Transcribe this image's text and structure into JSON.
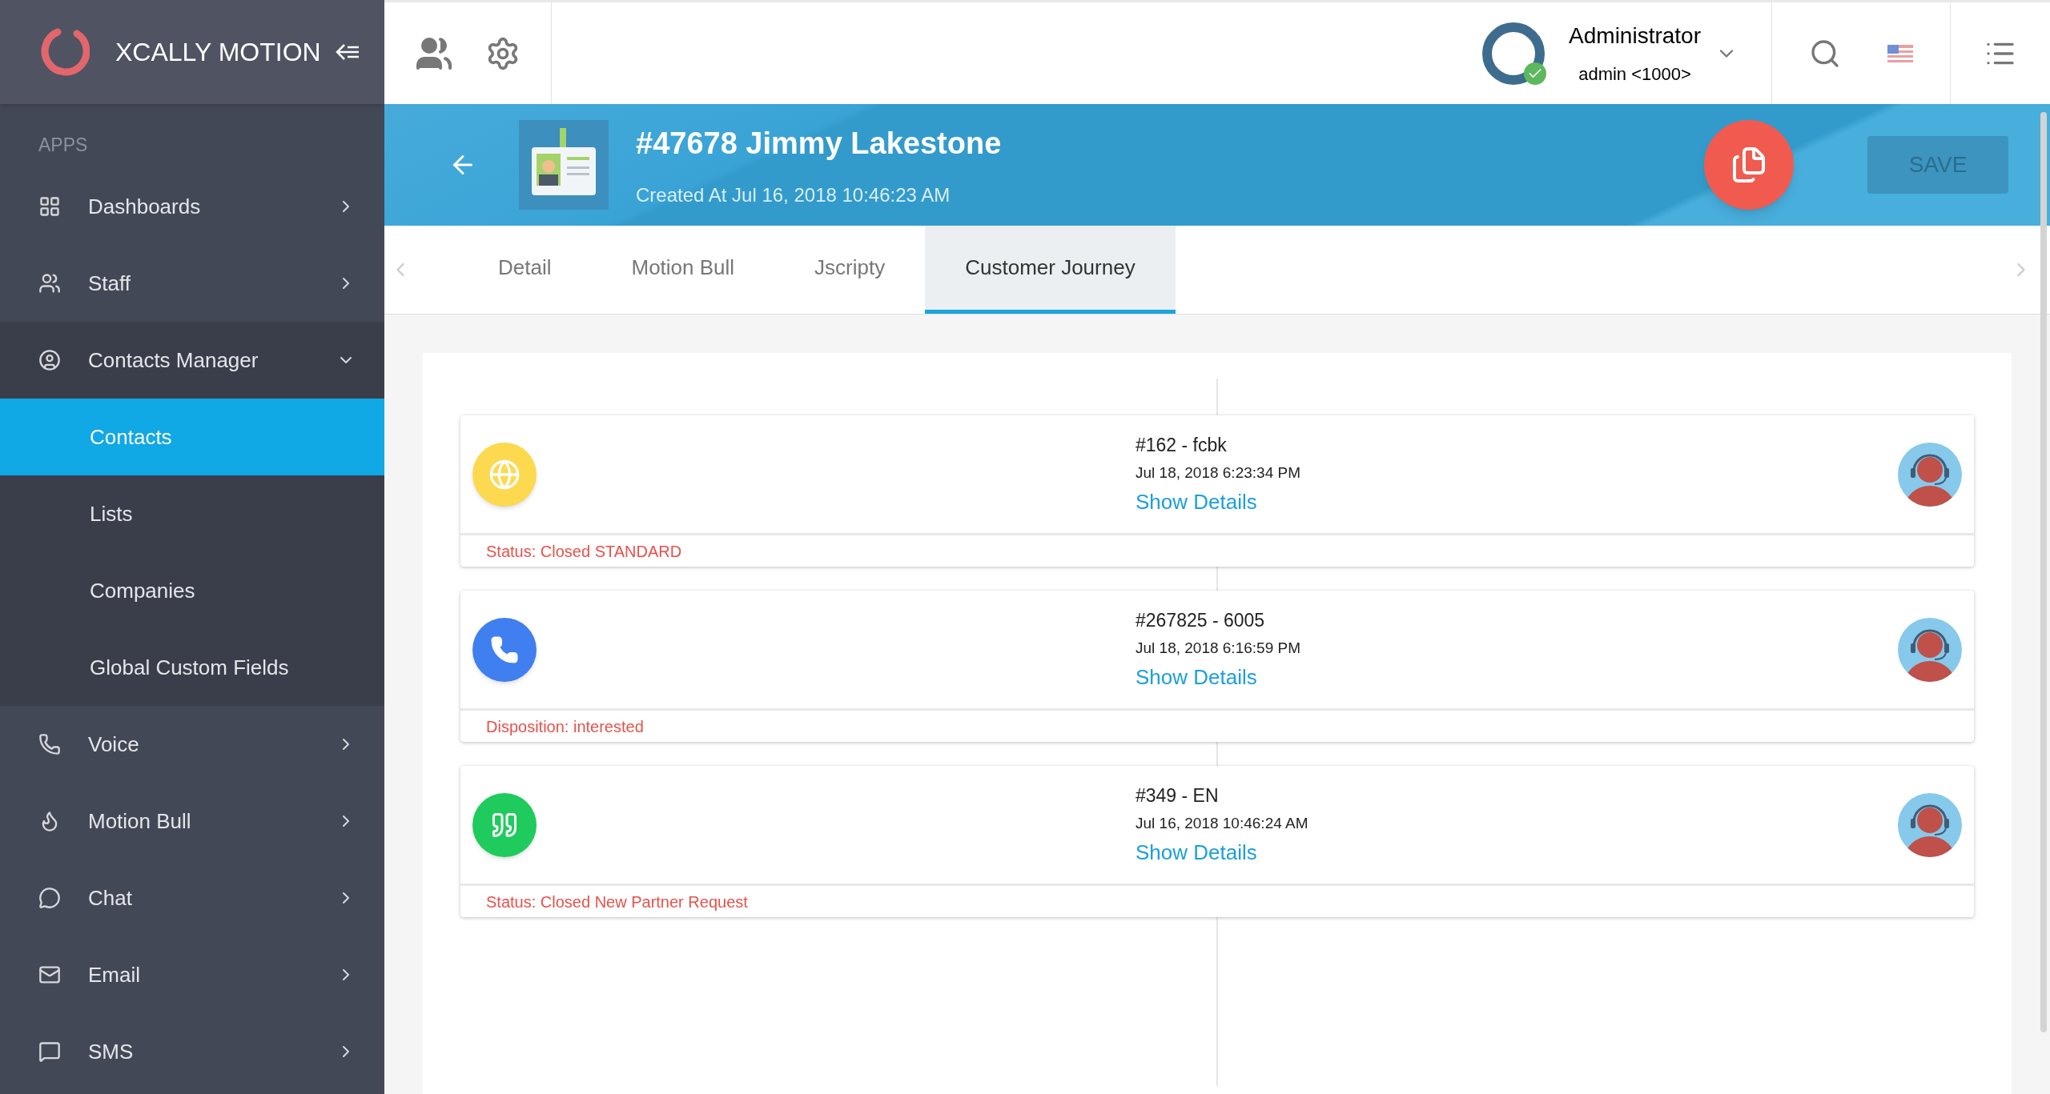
{
  "brand": {
    "name": "XCALLY MOTION"
  },
  "sidebar": {
    "section": "APPS",
    "items": [
      {
        "label": "Dashboards",
        "expanded": false
      },
      {
        "label": "Staff",
        "expanded": false
      },
      {
        "label": "Contacts Manager",
        "expanded": true,
        "children": [
          {
            "label": "Contacts",
            "selected": true
          },
          {
            "label": "Lists",
            "selected": false
          },
          {
            "label": "Companies",
            "selected": false
          },
          {
            "label": "Global Custom Fields",
            "selected": false
          }
        ]
      },
      {
        "label": "Voice",
        "expanded": false
      },
      {
        "label": "Motion Bull",
        "expanded": false
      },
      {
        "label": "Chat",
        "expanded": false
      },
      {
        "label": "Email",
        "expanded": false
      },
      {
        "label": "SMS",
        "expanded": false
      }
    ]
  },
  "user": {
    "name": "Administrator",
    "account": "admin <1000>",
    "online": true
  },
  "contact": {
    "title": "#47678 Jimmy Lakestone",
    "created": "Created At Jul 16, 2018 10:46:23 AM",
    "save": {
      "label": "SAVE",
      "disabled": true
    }
  },
  "tabs": [
    {
      "label": "Detail",
      "selected": false
    },
    {
      "label": "Motion Bull",
      "selected": false
    },
    {
      "label": "Jscripty",
      "selected": false
    },
    {
      "label": "Customer Journey",
      "selected": true
    }
  ],
  "journey": [
    {
      "kind": "social",
      "color": "#fdd94f",
      "title": "#162 - fcbk",
      "date": "Jul 18, 2018 6:23:34 PM",
      "link": "Show Details",
      "footer": "Status: Closed STANDARD"
    },
    {
      "kind": "voice",
      "color": "#3f7ff0",
      "title": "#267825 - 6005",
      "date": "Jul 18, 2018 6:16:59 PM",
      "link": "Show Details",
      "footer": "Disposition: interested"
    },
    {
      "kind": "chat",
      "color": "#1ecb5c",
      "title": "#349 - EN",
      "date": "Jul 16, 2018 10:46:24 AM",
      "link": "Show Details",
      "footer": "Status: Closed New Partner Request"
    }
  ]
}
